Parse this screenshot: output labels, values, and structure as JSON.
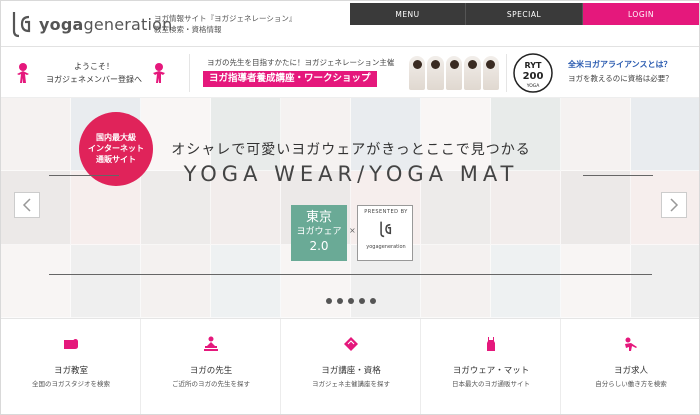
{
  "header": {
    "logo_text_bold": "yoga",
    "logo_text_light": "generation",
    "tagline_line1": "ヨガ情報サイト『ヨガジェネレーション』",
    "tagline_line2": "教室検索・資格情報",
    "nav": [
      {
        "label": "MENU"
      },
      {
        "label": "SPECIAL"
      },
      {
        "label": "LOGIN"
      }
    ]
  },
  "promo": {
    "welcome_line1": "ようこそ！",
    "welcome_line2": "ヨガジェネメンバー登録へ",
    "workshop_line1": "ヨガの先生を目指すかたに！ヨガジェネレーション主催",
    "workshop_line2": "ヨガ指導者養成講座・ワークショップ",
    "ryt_top": "RYT",
    "ryt_num": "200",
    "ryt_bottom": "YOGA",
    "ryt_line1": "全米ヨガアライアンスとは？",
    "ryt_line2": "ヨガを教えるのに資格は必要？"
  },
  "hero": {
    "badge_line1": "国内最大級",
    "badge_line2": "インターネット",
    "badge_line3": "通販サイト",
    "headline_jp": "オシャレで可愛いヨガウェアがきっとここで見つかる",
    "headline_en": "YOGA WEAR/YOGA MAT",
    "tokyo_line1": "東京",
    "tokyo_line2": "ヨガウェア",
    "tokyo_line3": "2.0",
    "cross": "×",
    "presented_by": "PRESENTED BY",
    "presented_logo": "yogageneration",
    "slide_count": 5,
    "arrow_prev_label": "<",
    "arrow_next_label": ">"
  },
  "categories": [
    {
      "title": "ヨガ教室",
      "sub": "全国のヨガスタジオを検索",
      "icon": "mat-icon"
    },
    {
      "title": "ヨガの先生",
      "sub": "ご近所のヨガの先生を探す",
      "icon": "teacher-icon"
    },
    {
      "title": "ヨガ講座・資格",
      "sub": "ヨガジェネ主催講座を探す",
      "icon": "certificate-icon"
    },
    {
      "title": "ヨガウェア・マット",
      "sub": "日本最大のヨガ通販サイト",
      "icon": "wear-icon"
    },
    {
      "title": "ヨガ求人",
      "sub": "自分らしい働き方を検索",
      "icon": "job-icon"
    }
  ],
  "colors": {
    "accent": "#e5187c",
    "nav_dark": "#3a3a3a",
    "badge": "#e0235a",
    "tokyo": "#6aaa96"
  }
}
